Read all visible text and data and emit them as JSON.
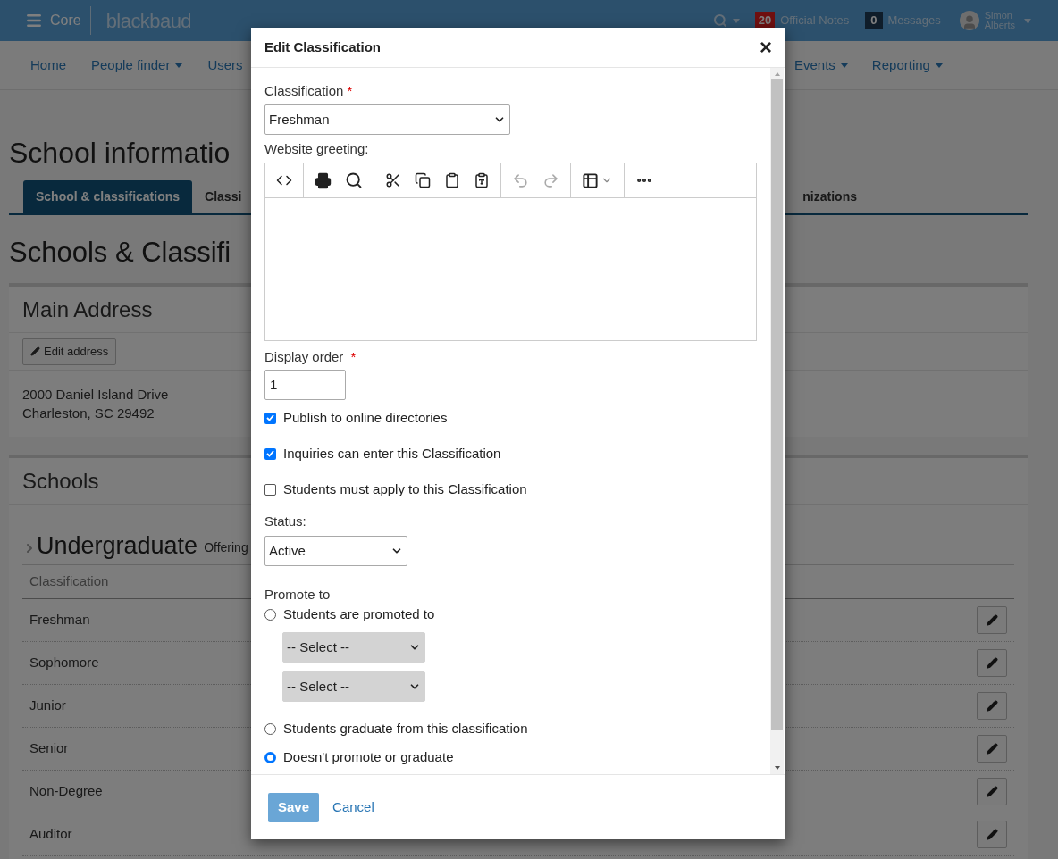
{
  "top_bar": {
    "menu_label": "Core",
    "logo": "blackbaud",
    "notes_count": "20",
    "notes_label": "Official Notes",
    "messages_count": "0",
    "messages_label": "Messages",
    "user_first": "Simon",
    "user_last": "Alberts"
  },
  "nav": [
    {
      "label": "Home",
      "dropdown": false
    },
    {
      "label": "People finder",
      "dropdown": true
    },
    {
      "label": "Users",
      "dropdown": false
    },
    {
      "label": "Events",
      "dropdown": true
    },
    {
      "label": "Reporting",
      "dropdown": true
    }
  ],
  "page_title": "School informatio",
  "tabs": [
    {
      "label": "School & classifications",
      "selected": true
    },
    {
      "label": "Classi",
      "selected": false
    },
    {
      "label": "nizations",
      "selected": false
    }
  ],
  "section_title": "Schools & Classifi",
  "address_panel": {
    "title": "Main Address",
    "button": "Edit address",
    "lines": [
      "2000 Daniel Island Drive",
      "Charleston, SC 29492"
    ]
  },
  "schools_panel": {
    "title": "Schools",
    "group_name": "Undergraduate",
    "group_note": "Offering",
    "column": "Classification",
    "rows": [
      {
        "name": "Freshman"
      },
      {
        "name": "Sophomore"
      },
      {
        "name": "Junior"
      },
      {
        "name": "Senior"
      },
      {
        "name": "Non-Degree"
      },
      {
        "name": "Auditor"
      }
    ]
  },
  "dialog": {
    "title": "Edit Classification",
    "close": "×",
    "classification": {
      "label": "Classification",
      "required_mark": "*",
      "value": "Freshman"
    },
    "greeting": {
      "label": "Website greeting:",
      "undo_enabled": false,
      "redo_enabled": false
    },
    "display_order": {
      "label": "Display order",
      "required_mark": "*",
      "value": "1"
    },
    "checkboxes": [
      {
        "label": "Publish to online directories",
        "checked": true
      },
      {
        "label": "Inquiries can enter this Classification",
        "checked": true
      },
      {
        "label": "Students must apply to this Classification",
        "checked": false
      }
    ],
    "status": {
      "label": "Status:",
      "value": "Active"
    },
    "promote": {
      "label": "Promote to",
      "options": [
        {
          "label": "Students are promoted to",
          "selected": false,
          "selects": [
            "-- Select --",
            "-- Select --"
          ]
        },
        {
          "label": "Students graduate from this classification",
          "selected": false
        },
        {
          "label": "Doesn't promote or graduate",
          "selected": true
        }
      ]
    },
    "save": "Save",
    "cancel": "Cancel"
  }
}
